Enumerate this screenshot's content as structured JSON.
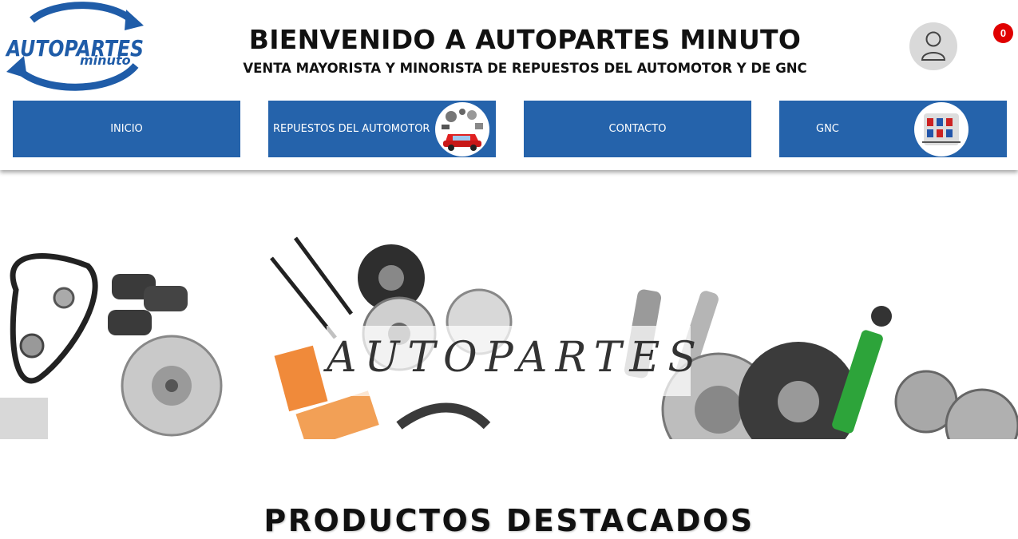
{
  "header": {
    "logo_text_top": "AUTOPARTES",
    "logo_text_bottom": "minuto",
    "title": "BIENVENIDO A AUTOPARTES MINUTO",
    "subtitle": "VENTA MAYORISTA Y MINORISTA DE REPUESTOS DEL AUTOMOTOR Y DE GNC",
    "account_icon": "user-icon",
    "cart_count": "0"
  },
  "nav": {
    "items": [
      {
        "label": "INICIO"
      },
      {
        "label": "REPUESTOS DEL AUTOMOTOR"
      },
      {
        "label": "CONTACTO"
      },
      {
        "label": "GNC"
      }
    ]
  },
  "banner": {
    "text": "AUTOPARTES"
  },
  "featured": {
    "title": "PRODUCTOS DESTACADOS"
  },
  "colors": {
    "nav_blue": "#2563ab",
    "logo_blue": "#1f5ca8",
    "badge_red": "#e00000"
  }
}
